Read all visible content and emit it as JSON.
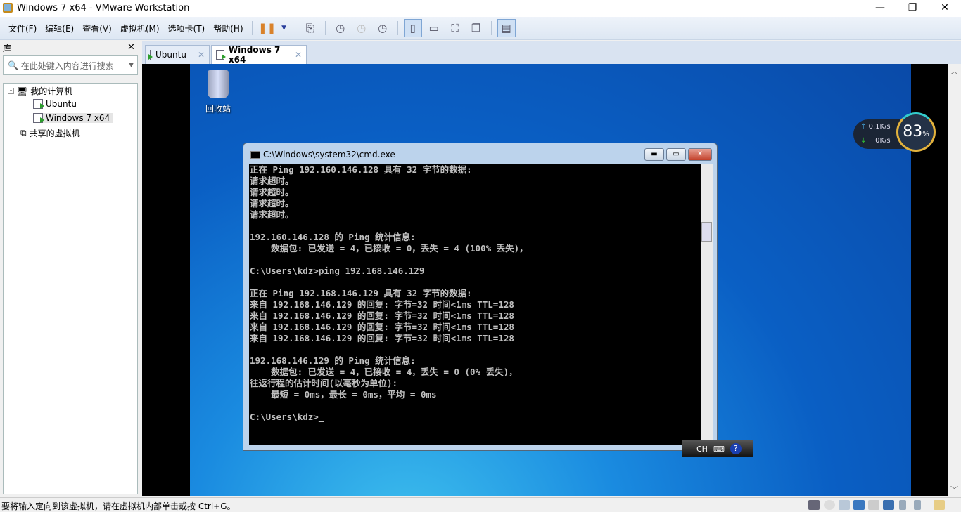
{
  "window": {
    "title": "Windows 7 x64 - VMware Workstation",
    "minimize": "—",
    "maximize": "❐",
    "close": "✕"
  },
  "menu": [
    "文件(F)",
    "编辑(E)",
    "查看(V)",
    "虚拟机(M)",
    "选项卡(T)",
    "帮助(H)"
  ],
  "sidebar": {
    "title": "库",
    "close": "✕",
    "search_placeholder": "在此处键入内容进行搜索",
    "tree": {
      "root": "我的计算机",
      "vms": [
        "Ubuntu",
        "Windows 7 x64"
      ],
      "shared": "共享的虚拟机"
    }
  },
  "tabs": [
    {
      "label": "Ubuntu",
      "active": false
    },
    {
      "label": "Windows 7 x64",
      "active": true
    }
  ],
  "desktop": {
    "recycle_bin": "回收站"
  },
  "cmd": {
    "title": "C:\\Windows\\system32\\cmd.exe",
    "lines": [
      "正在 Ping 192.160.146.128 具有 32 字节的数据:",
      "请求超时。",
      "请求超时。",
      "请求超时。",
      "请求超时。",
      "",
      "192.160.146.128 的 Ping 统计信息:",
      "    数据包: 已发送 = 4，已接收 = 0，丢失 = 4 (100% 丢失)，",
      "",
      "C:\\Users\\kdz>ping 192.168.146.129",
      "",
      "正在 Ping 192.168.146.129 具有 32 字节的数据:",
      "来自 192.168.146.129 的回复: 字节=32 时间<1ms TTL=128",
      "来自 192.168.146.129 的回复: 字节=32 时间<1ms TTL=128",
      "来自 192.168.146.129 的回复: 字节=32 时间<1ms TTL=128",
      "来自 192.168.146.129 的回复: 字节=32 时间<1ms TTL=128",
      "",
      "192.168.146.129 的 Ping 统计信息:",
      "    数据包: 已发送 = 4，已接收 = 4，丢失 = 0 (0% 丢失)，",
      "往返行程的估计时间(以毫秒为单位):",
      "    最短 = 0ms，最长 = 0ms，平均 = 0ms",
      "",
      "C:\\Users\\kdz>_"
    ]
  },
  "ime": {
    "label": "CH"
  },
  "netmon": {
    "up": "0.1K/s",
    "down": "0K/s",
    "percent": "83",
    "percent_sign": "%"
  },
  "status": {
    "message": "要将输入定向到该虚拟机，请在虚拟机内部单击或按 Ctrl+G。"
  }
}
